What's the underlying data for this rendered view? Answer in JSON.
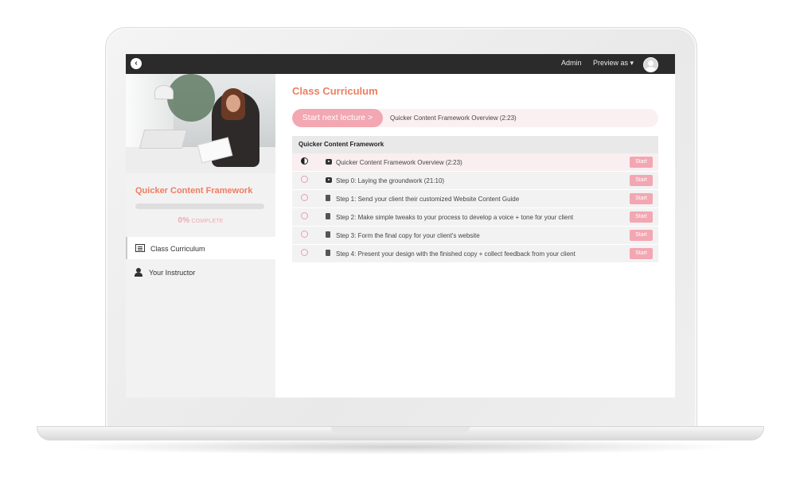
{
  "topbar": {
    "admin_label": "Admin",
    "preview_label": "Preview as ▾"
  },
  "sidebar": {
    "course_title": "Quicker Content Framework",
    "progress": {
      "percent_label": "0%",
      "complete_label": "COMPLETE",
      "fraction": 0
    },
    "nav": [
      {
        "label": "Class Curriculum",
        "icon": "curriculum-list-icon",
        "active": true
      },
      {
        "label": "Your Instructor",
        "icon": "instructor-person-icon",
        "active": false
      }
    ]
  },
  "main": {
    "title": "Class Curriculum",
    "next_lecture": {
      "button_label": "Start next lecture  >",
      "title": "Quicker Content Framework Overview (2:23)"
    },
    "section": {
      "title": "Quicker Content Framework",
      "lectures": [
        {
          "title": "Quicker Content Framework Overview (2:23)",
          "type": "video",
          "status": "in-progress",
          "action": "Start"
        },
        {
          "title": "Step 0: Laying the groundwork (21:10)",
          "type": "video",
          "status": "not-started",
          "action": "Start"
        },
        {
          "title": "Step 1: Send your client their customized Website Content Guide",
          "type": "document",
          "status": "not-started",
          "action": "Start"
        },
        {
          "title": "Step 2: Make simple tweaks to your process to develop a voice + tone for your client",
          "type": "document",
          "status": "not-started",
          "action": "Start"
        },
        {
          "title": "Step 3: Form the final copy for your client's website",
          "type": "document",
          "status": "not-started",
          "action": "Start"
        },
        {
          "title": "Step 4: Present your design with the finished copy + collect feedback from your client",
          "type": "document",
          "status": "not-started",
          "action": "Start"
        }
      ]
    }
  },
  "colors": {
    "accent": "#ef7d62",
    "pink": "#f2a7b2",
    "topbar": "#2b2b2b"
  }
}
